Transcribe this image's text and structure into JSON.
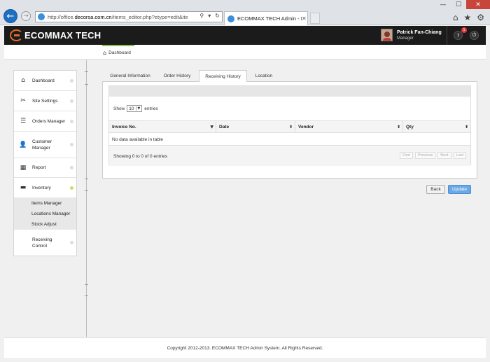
{
  "browser": {
    "url_prefix": "http://office.",
    "url_host": "decorsa.com.cn",
    "url_path": "/items_editor.php?etype=edit&ite",
    "tab_title": "ECOMMAX TECH Admin - It...",
    "window_buttons": [
      "—",
      "☐",
      "✕"
    ],
    "right_icons": [
      "⌂",
      "★",
      "⚙"
    ]
  },
  "header": {
    "logo_text": "ECOMMAX TECH",
    "user_name": "Patrick Fan-Chiang",
    "user_role": "Manager",
    "notif_count": "1"
  },
  "breadcrumb": {
    "label": "Dashboard"
  },
  "sidebar": {
    "items": [
      {
        "label": "Dashboard",
        "icon": "⌂"
      },
      {
        "label": "Site Settings",
        "icon": "✂"
      },
      {
        "label": "Orders Manager",
        "icon": "☰"
      },
      {
        "label": "Customer Manager",
        "icon": "👤"
      },
      {
        "label": "Report",
        "icon": "▦"
      },
      {
        "label": "Inventory",
        "icon": "▬"
      },
      {
        "label": "Receiving Control",
        "icon": ""
      }
    ],
    "sub_items": [
      "Items Manager",
      "Locations Manager",
      "Stock Adjust"
    ]
  },
  "tabs": [
    "General Information",
    "Order History",
    "Receiving History",
    "Location"
  ],
  "active_tab": "Receiving History",
  "table": {
    "show_label": "Show",
    "show_value": "10",
    "entries_label": "entries",
    "columns": [
      "Invoice No.",
      "Date",
      "Vendor",
      "Qty"
    ],
    "empty_message": "No data available in table",
    "info": "Showing 0 to 0 of 0 entries",
    "pager": [
      "First",
      "Previous",
      "Next",
      "Last"
    ]
  },
  "buttons": {
    "back": "Back",
    "update": "Update"
  },
  "footer": {
    "copyright": "Copyright 2012-2013. ECOMMAX TECH Admin System. All Rights Reserved."
  },
  "colors": {
    "header_bg": "#1b1b1b",
    "brand_orange": "#e26a2c",
    "accent_green": "#8bc34a",
    "update_blue": "#6aa9e6"
  }
}
